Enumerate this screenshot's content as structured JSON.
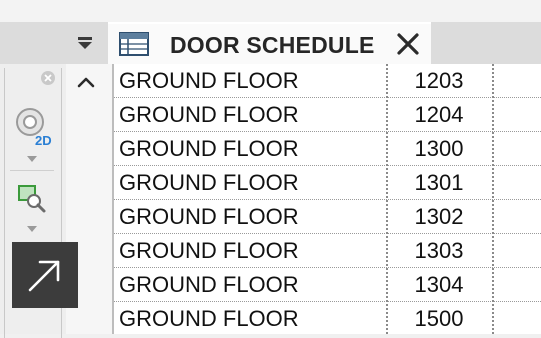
{
  "tab": {
    "title": "DOOR SCHEDULE"
  },
  "schedule": {
    "rows": [
      {
        "level": "GROUND FLOOR",
        "mark": "1203"
      },
      {
        "level": "GROUND FLOOR",
        "mark": "1204"
      },
      {
        "level": "GROUND FLOOR",
        "mark": "1300"
      },
      {
        "level": "GROUND FLOOR",
        "mark": "1301"
      },
      {
        "level": "GROUND FLOOR",
        "mark": "1302"
      },
      {
        "level": "GROUND FLOOR",
        "mark": "1303"
      },
      {
        "level": "GROUND FLOOR",
        "mark": "1304"
      },
      {
        "level": "GROUND FLOOR",
        "mark": "1500"
      }
    ]
  },
  "nav_bar": {
    "wheel_label": "2D"
  },
  "icons": {
    "tab_dropdown": "menu-dropdown-icon",
    "tab_icon": "schedule-table-icon",
    "tab_close": "close-icon",
    "panel_close": "close-icon",
    "nav_wheel": "steering-wheel-2d-icon",
    "zoom": "zoom-region-icon",
    "scroll_up": "chevron-up-icon",
    "launch": "arrow-up-right-icon"
  },
  "colors": {
    "accent_blue": "#2a7fd4",
    "zoom_green": "#3b9a3b"
  }
}
